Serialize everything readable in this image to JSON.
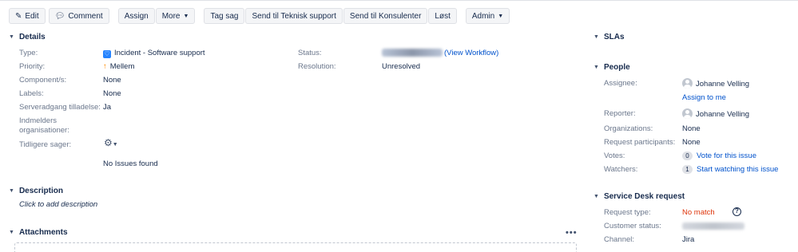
{
  "toolbar": {
    "edit": "Edit",
    "comment": "Comment",
    "assign": "Assign",
    "more": "More",
    "tag_sag": "Tag sag",
    "send_teknisk": "Send til Teknisk support",
    "send_konsulenter": "Send til Konsulenter",
    "lost": "Løst",
    "admin": "Admin"
  },
  "details": {
    "title": "Details",
    "type_label": "Type:",
    "type_value": "Incident - Software support",
    "priority_label": "Priority:",
    "priority_value": "Mellem",
    "components_label": "Component/s:",
    "components_value": "None",
    "labels_label": "Labels:",
    "labels_value": "None",
    "serveradgang_label": "Serveradgang tilladelse:",
    "serveradgang_value": "Ja",
    "indmelders_label_1": "Indmelders",
    "indmelders_label_2": "organisationer:",
    "tidligere_label": "Tidligere sager:",
    "no_issues": "No Issues found",
    "status_label": "Status:",
    "status_link": "(View Workflow)",
    "resolution_label": "Resolution:",
    "resolution_value": "Unresolved"
  },
  "description": {
    "title": "Description",
    "placeholder": "Click to add description"
  },
  "attachments": {
    "title": "Attachments",
    "more": "•••"
  },
  "slas": {
    "title": "SLAs"
  },
  "people": {
    "title": "People",
    "assignee_label": "Assignee:",
    "assignee_name": "Johanne Velling",
    "assign_to_me": "Assign to me",
    "reporter_label": "Reporter:",
    "reporter_name": "Johanne Velling",
    "organizations_label": "Organizations:",
    "organizations_value": "None",
    "participants_label": "Request participants:",
    "participants_value": "None",
    "votes_label": "Votes:",
    "votes_count": "0",
    "votes_link": "Vote for this issue",
    "watchers_label": "Watchers:",
    "watchers_count": "1",
    "watchers_link": "Start watching this issue"
  },
  "service_desk": {
    "title": "Service Desk request",
    "request_type_label": "Request type:",
    "request_type_value": "No match",
    "customer_status_label": "Customer status:",
    "channel_label": "Channel:",
    "channel_value": "Jira"
  }
}
